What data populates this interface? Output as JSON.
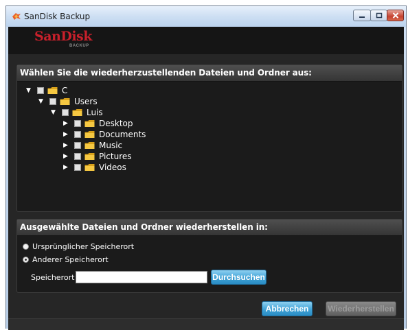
{
  "window": {
    "title": "SanDisk Backup",
    "icon": "sandisk-app-icon",
    "controls": [
      "minimize-icon",
      "maximize-icon",
      "close-icon"
    ]
  },
  "brand": {
    "logo_text": "SanDisk",
    "logo_sub": "BACKUP",
    "logo_color": "#c8202b"
  },
  "files_panel": {
    "heading": "Wählen Sie die wiederherzustellenden Dateien und Ordner aus:",
    "tree": [
      {
        "label": "C",
        "expanded": true,
        "level": 0
      },
      {
        "label": "Users",
        "expanded": true,
        "level": 1
      },
      {
        "label": "Luis",
        "expanded": true,
        "level": 2
      },
      {
        "label": "Desktop",
        "expanded": false,
        "level": 3
      },
      {
        "label": "Documents",
        "expanded": false,
        "level": 3
      },
      {
        "label": "Music",
        "expanded": false,
        "level": 3
      },
      {
        "label": "Pictures",
        "expanded": false,
        "level": 3
      },
      {
        "label": "Videos",
        "expanded": false,
        "level": 3
      }
    ]
  },
  "restore_panel": {
    "heading": "Ausgewählte Dateien und Ordner wiederherstellen in:",
    "option_original": "Ursprünglicher Speicherort",
    "option_other": "Anderer Speicherort",
    "selected_option": "Anderer Speicherort",
    "location_label": "Speicherort",
    "location_value": "",
    "browse_label": "Durchsuchen"
  },
  "actions": {
    "cancel_label": "Abbrechen",
    "restore_label": "Wiederherstellen",
    "restore_enabled": false
  },
  "colors": {
    "accent_blue": "#3fa2d6",
    "background": "#262626",
    "panel_header": "#404040"
  }
}
